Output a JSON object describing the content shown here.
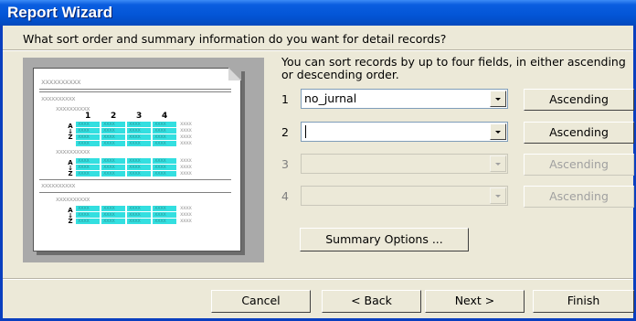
{
  "window": {
    "title": "Report Wizard"
  },
  "question": "What sort order and summary information do you want for detail records?",
  "hint": "You can sort records by up to four fields, in either ascending or descending order.",
  "preview": {
    "placeholder": "xxxxxxxxxx",
    "cell_text": "xxxx",
    "column_numbers": [
      "1",
      "2",
      "3",
      "4"
    ],
    "az_label": "A Z"
  },
  "sort_rows": [
    {
      "number": "1",
      "value": "no_jurnal",
      "order": "Ascending",
      "enabled": true
    },
    {
      "number": "2",
      "value": "",
      "order": "Ascending",
      "enabled": true
    },
    {
      "number": "3",
      "value": "",
      "order": "Ascending",
      "enabled": false
    },
    {
      "number": "4",
      "value": "",
      "order": "Ascending",
      "enabled": false
    }
  ],
  "summary_button": "Summary Options ...",
  "buttons": {
    "cancel": "Cancel",
    "back": "< Back",
    "next": "Next >",
    "finish": "Finish"
  }
}
